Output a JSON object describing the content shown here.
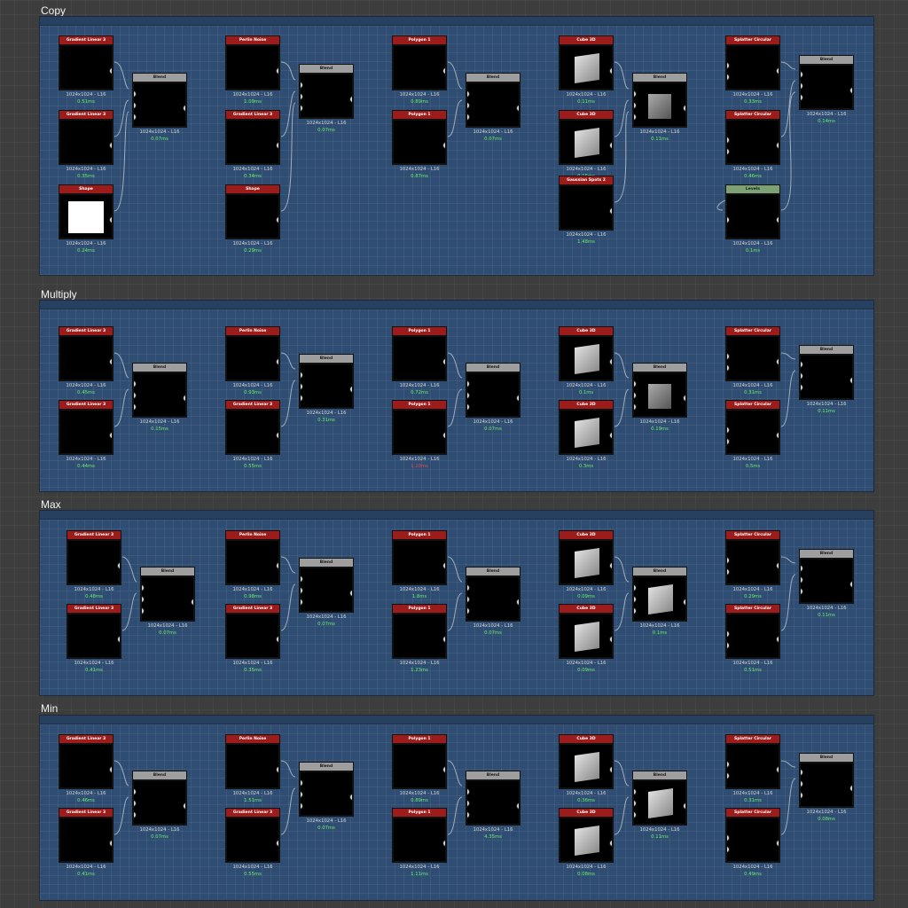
{
  "colors": {
    "canvas": "#3d3d3d",
    "frame": "#2f4d72",
    "header_red": "#9c1c1c",
    "header_blend": "#9e9e9e",
    "header_levels": "#7da074",
    "time_ok": "#6cf06c",
    "time_bad": "#e84848"
  },
  "frames": [
    {
      "title": "Copy"
    },
    {
      "title": "Multiply"
    },
    {
      "title": "Max"
    },
    {
      "title": "Min"
    }
  ],
  "res": "1024x1024 - L16",
  "copy": {
    "c1n1": {
      "title": "Gradient Linear 3",
      "time": "0.51ms"
    },
    "c1n2": {
      "title": "Gradient Linear 3",
      "time": "0.35ms"
    },
    "c1n3": {
      "title": "Shape",
      "time": "0.24ms"
    },
    "c1b": {
      "title": "Blend",
      "time": "0.07ms"
    },
    "c2n1": {
      "title": "Perlin Noise",
      "time": "1.09ms"
    },
    "c2n2": {
      "title": "Gradient Linear 3",
      "time": "0.34ms"
    },
    "c2n3": {
      "title": "Shape",
      "time": "0.29ms"
    },
    "c2b": {
      "title": "Blend",
      "time": "0.07ms"
    },
    "c3n1": {
      "title": "Polygon 1",
      "time": "0.89ms"
    },
    "c3n2": {
      "title": "Polygon 1",
      "time": "0.87ms"
    },
    "c3b": {
      "title": "Blend",
      "time": "0.07ms"
    },
    "c4n1": {
      "title": "Cube 3D",
      "time": "0.11ms"
    },
    "c4n2": {
      "title": "Cube 3D",
      "time": "0.15ms"
    },
    "c4n3": {
      "title": "Gaussian Spots 2",
      "time": "1.48ms"
    },
    "c4b": {
      "title": "Blend",
      "time": "0.11ms"
    },
    "c5n1": {
      "title": "Splatter Circular",
      "time": "0.33ms"
    },
    "c5n2": {
      "title": "Splatter Circular",
      "time": "0.46ms"
    },
    "c5n3": {
      "title": "Levels",
      "time": "0.1ms"
    },
    "c5b": {
      "title": "Blend",
      "time": "0.14ms"
    }
  },
  "multiply": {
    "c1n1": {
      "title": "Gradient Linear 3",
      "time": "0.45ms"
    },
    "c1n2": {
      "title": "Gradient Linear 3",
      "time": "0.44ms"
    },
    "c1b": {
      "title": "Blend",
      "time": "0.15ms"
    },
    "c2n1": {
      "title": "Perlin Noise",
      "time": "0.93ms"
    },
    "c2n2": {
      "title": "Gradient Linear 3",
      "time": "0.55ms"
    },
    "c2b": {
      "title": "Blend",
      "time": "0.31ms"
    },
    "c3n1": {
      "title": "Polygon 1",
      "time": "0.72ms"
    },
    "c3n2": {
      "title": "Polygon 1",
      "time": "1.20ms"
    },
    "c3b": {
      "title": "Blend",
      "time": "0.07ms"
    },
    "c4n1": {
      "title": "Cube 3D",
      "time": "0.1ms"
    },
    "c4n2": {
      "title": "Cube 3D",
      "time": "0.3ms"
    },
    "c4b": {
      "title": "Blend",
      "time": "0.19ms"
    },
    "c5n1": {
      "title": "Splatter Circular",
      "time": "0.31ms"
    },
    "c5n2": {
      "title": "Splatter Circular",
      "time": "0.5ms"
    },
    "c5b": {
      "title": "Blend",
      "time": "0.11ms"
    }
  },
  "max": {
    "c1n1": {
      "title": "Gradient Linear 3",
      "time": "0.48ms"
    },
    "c1n2": {
      "title": "Gradient Linear 3",
      "time": "0.41ms"
    },
    "c1b": {
      "title": "Blend",
      "time": "0.07ms"
    },
    "c2n1": {
      "title": "Perlin Noise",
      "time": "0.98ms"
    },
    "c2n2": {
      "title": "Gradient Linear 3",
      "time": "0.35ms"
    },
    "c2b": {
      "title": "Blend",
      "time": "0.07ms"
    },
    "c3n1": {
      "title": "Polygon 1",
      "time": "1.8ms"
    },
    "c3n2": {
      "title": "Polygon 1",
      "time": "1.23ms"
    },
    "c3b": {
      "title": "Blend",
      "time": "0.07ms"
    },
    "c4n1": {
      "title": "Cube 3D",
      "time": "0.09ms"
    },
    "c4n2": {
      "title": "Cube 3D",
      "time": "0.09ms"
    },
    "c4b": {
      "title": "Blend",
      "time": "0.1ms"
    },
    "c5n1": {
      "title": "Splatter Circular",
      "time": "0.29ms"
    },
    "c5n2": {
      "title": "Splatter Circular",
      "time": "0.51ms"
    },
    "c5b": {
      "title": "Blend",
      "time": "0.11ms"
    }
  },
  "min": {
    "c1n1": {
      "title": "Gradient Linear 3",
      "time": "0.46ms"
    },
    "c1n2": {
      "title": "Gradient Linear 3",
      "time": "0.41ms"
    },
    "c1b": {
      "title": "Blend",
      "time": "0.07ms"
    },
    "c2n1": {
      "title": "Perlin Noise",
      "time": "1.51ms"
    },
    "c2n2": {
      "title": "Gradient Linear 3",
      "time": "0.55ms"
    },
    "c2b": {
      "title": "Blend",
      "time": "0.07ms"
    },
    "c3n1": {
      "title": "Polygon 1",
      "time": "0.89ms"
    },
    "c3n2": {
      "title": "Polygon 1",
      "time": "1.11ms"
    },
    "c3b": {
      "title": "Blend",
      "time": "4.35ms"
    },
    "c4n1": {
      "title": "Cube 3D",
      "time": "0.36ms"
    },
    "c4n2": {
      "title": "Cube 3D",
      "time": "0.08ms"
    },
    "c4b": {
      "title": "Blend",
      "time": "0.11ms"
    },
    "c5n1": {
      "title": "Splatter Circular",
      "time": "0.31ms"
    },
    "c5n2": {
      "title": "Splatter Circular",
      "time": "0.49ms"
    },
    "c5b": {
      "title": "Blend",
      "time": "0.08ms"
    }
  }
}
